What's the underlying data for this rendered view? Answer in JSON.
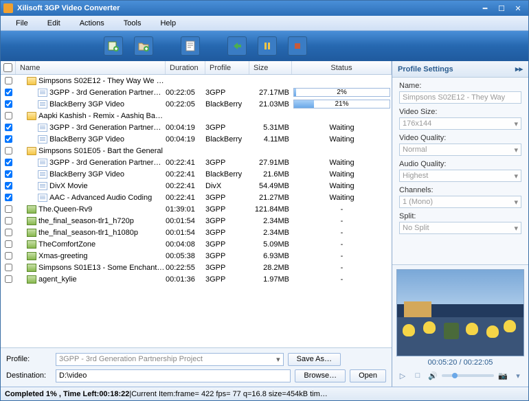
{
  "title": "Xilisoft 3GP Video Converter",
  "menubar": [
    "File",
    "Edit",
    "Actions",
    "Tools",
    "Help"
  ],
  "columns": {
    "name": "Name",
    "duration": "Duration",
    "profile": "Profile",
    "size": "Size",
    "status": "Status"
  },
  "rows": [
    {
      "chk": false,
      "indent": 1,
      "icon": "folder",
      "name": "Simpsons S02E12 - They Way We …",
      "dur": "",
      "prof": "",
      "size": "",
      "status": ""
    },
    {
      "chk": true,
      "indent": 2,
      "icon": "file",
      "name": "3GPP - 3rd Generation Partner…",
      "dur": "00:22:05",
      "prof": "3GPP",
      "size": "27.17MB",
      "status": "progress",
      "pct": 2
    },
    {
      "chk": true,
      "indent": 2,
      "icon": "file",
      "name": "BlackBerry 3GP Video",
      "dur": "00:22:05",
      "prof": "BlackBerry",
      "size": "21.03MB",
      "status": "progress",
      "pct": 21
    },
    {
      "chk": false,
      "indent": 1,
      "icon": "folder",
      "name": "Aapki Kashish - Remix - Aashiq Ba…",
      "dur": "",
      "prof": "",
      "size": "",
      "status": ""
    },
    {
      "chk": true,
      "indent": 2,
      "icon": "file",
      "name": "3GPP - 3rd Generation Partner…",
      "dur": "00:04:19",
      "prof": "3GPP",
      "size": "5.31MB",
      "status": "Waiting"
    },
    {
      "chk": true,
      "indent": 2,
      "icon": "file",
      "name": "BlackBerry 3GP Video",
      "dur": "00:04:19",
      "prof": "BlackBerry",
      "size": "4.11MB",
      "status": "Waiting"
    },
    {
      "chk": false,
      "indent": 1,
      "icon": "folder",
      "name": "Simpsons S01E05 - Bart the General",
      "dur": "",
      "prof": "",
      "size": "",
      "status": ""
    },
    {
      "chk": true,
      "indent": 2,
      "icon": "file",
      "name": "3GPP - 3rd Generation Partner…",
      "dur": "00:22:41",
      "prof": "3GPP",
      "size": "27.91MB",
      "status": "Waiting"
    },
    {
      "chk": true,
      "indent": 2,
      "icon": "file",
      "name": "BlackBerry 3GP Video",
      "dur": "00:22:41",
      "prof": "BlackBerry",
      "size": "21.6MB",
      "status": "Waiting"
    },
    {
      "chk": true,
      "indent": 2,
      "icon": "file",
      "name": "DivX Movie",
      "dur": "00:22:41",
      "prof": "DivX",
      "size": "54.49MB",
      "status": "Waiting"
    },
    {
      "chk": true,
      "indent": 2,
      "icon": "file",
      "name": "AAC - Advanced Audio Coding",
      "dur": "00:22:41",
      "prof": "3GPP",
      "size": "21.27MB",
      "status": "Waiting"
    },
    {
      "chk": false,
      "indent": 1,
      "icon": "video",
      "name": "The.Queen-Rv9",
      "dur": "01:39:01",
      "prof": "3GPP",
      "size": "121.84MB",
      "status": "-"
    },
    {
      "chk": false,
      "indent": 1,
      "icon": "video",
      "name": "the_final_season-tlr1_h720p",
      "dur": "00:01:54",
      "prof": "3GPP",
      "size": "2.34MB",
      "status": "-"
    },
    {
      "chk": false,
      "indent": 1,
      "icon": "video",
      "name": "the_final_season-tlr1_h1080p",
      "dur": "00:01:54",
      "prof": "3GPP",
      "size": "2.34MB",
      "status": "-"
    },
    {
      "chk": false,
      "indent": 1,
      "icon": "video",
      "name": "TheComfortZone",
      "dur": "00:04:08",
      "prof": "3GPP",
      "size": "5.09MB",
      "status": "-"
    },
    {
      "chk": false,
      "indent": 1,
      "icon": "video",
      "name": "Xmas-greeting",
      "dur": "00:05:38",
      "prof": "3GPP",
      "size": "6.93MB",
      "status": "-"
    },
    {
      "chk": false,
      "indent": 1,
      "icon": "video",
      "name": "Simpsons S01E13 - Some Enchant…",
      "dur": "00:22:55",
      "prof": "3GPP",
      "size": "28.2MB",
      "status": "-"
    },
    {
      "chk": false,
      "indent": 1,
      "icon": "video",
      "name": "agent_kylie",
      "dur": "00:01:36",
      "prof": "3GPP",
      "size": "1.97MB",
      "status": "-"
    }
  ],
  "bottom": {
    "profile_label": "Profile:",
    "profile_value": "3GPP - 3rd Generation Partnership Project",
    "saveas": "Save As…",
    "dest_label": "Destination:",
    "dest_value": "D:\\video",
    "browse": "Browse…",
    "open": "Open"
  },
  "side": {
    "header": "Profile Settings",
    "name_label": "Name:",
    "name_value": "Simpsons S02E12 - They Way",
    "videosize_label": "Video Size:",
    "videosize_value": "176x144",
    "videoq_label": "Video Quality:",
    "videoq_value": "Normal",
    "audioq_label": "Audio Quality:",
    "audioq_value": "Highest",
    "channels_label": "Channels:",
    "channels_value": "1 (Mono)",
    "split_label": "Split:",
    "split_value": "No Split"
  },
  "preview": {
    "time": "00:05:20 / 00:22:05"
  },
  "statusbar": {
    "completed": "Completed 1% , Time Left:00:18:22",
    "sep": " | ",
    "current": "Current Item:frame=  422 fps= 77 q=16.8 size=454kB tim…"
  }
}
